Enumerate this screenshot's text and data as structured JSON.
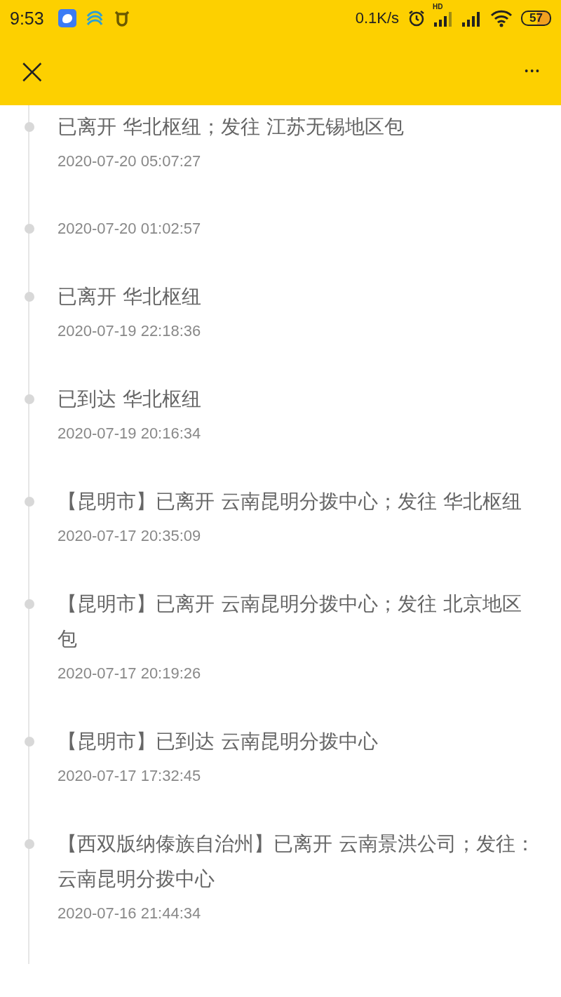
{
  "status_bar": {
    "time": "9:53",
    "speed": "0.1K/s",
    "hd": "HD",
    "battery": "57"
  },
  "nav": {
    "close": "×",
    "more": "•••"
  },
  "events": [
    {
      "title": "已离开 华北枢纽；发往 江苏无锡地区包",
      "time": "2020-07-20 05:07:27"
    },
    {
      "time": "2020-07-20 01:02:57"
    },
    {
      "title": "已离开 华北枢纽",
      "time": "2020-07-19 22:18:36"
    },
    {
      "title": "已到达 华北枢纽",
      "time": "2020-07-19 20:16:34"
    },
    {
      "title": "【昆明市】已离开 云南昆明分拨中心；发往 华北枢纽",
      "time": "2020-07-17 20:35:09"
    },
    {
      "title": "【昆明市】已离开 云南昆明分拨中心；发往 北京地区包",
      "time": "2020-07-17 20:19:26"
    },
    {
      "title": "【昆明市】已到达 云南昆明分拨中心",
      "time": "2020-07-17 17:32:45"
    },
    {
      "title": "【西双版纳傣族自治州】已离开 云南景洪公司；发往：云南昆明分拨中心",
      "time": "2020-07-16 21:44:34"
    }
  ]
}
